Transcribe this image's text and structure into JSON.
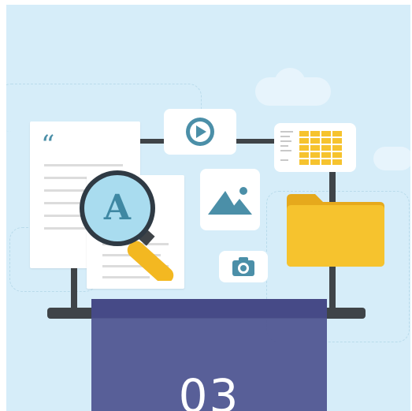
{
  "illustration": {
    "quote_mark": "“",
    "magnifier_letter": "A",
    "icons": [
      "play-icon",
      "image-mountains-icon",
      "camera-icon",
      "spreadsheet-icon",
      "folder-icon",
      "document-icon",
      "magnifier-icon"
    ]
  },
  "overlay": {
    "number": "03"
  },
  "colors": {
    "background": "#d6edf9",
    "accent_blue": "#4b8fa8",
    "folder_yellow": "#f6c32e",
    "magnifier_handle": "#f3b821",
    "overlay_purple": "#515792"
  }
}
